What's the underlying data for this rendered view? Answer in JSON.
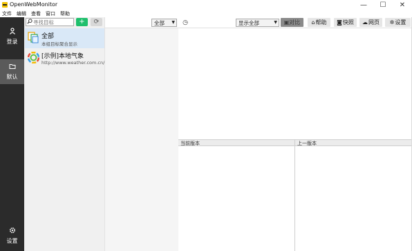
{
  "window": {
    "title": "OpenWebMonitor",
    "minimize": "—",
    "maximize": "☐",
    "close": "✕"
  },
  "menu": [
    "文件",
    "编辑",
    "查看",
    "窗口",
    "帮助"
  ],
  "nav": {
    "login": {
      "label": "登录",
      "icon": "person-icon"
    },
    "default": {
      "label": "默认",
      "icon": "folder-icon"
    },
    "settings": {
      "label": "设置",
      "icon": "gear-icon"
    }
  },
  "search": {
    "placeholder": "寻找目标",
    "value": ""
  },
  "list": {
    "items": [
      {
        "title": "全部",
        "subtitle": "本组目标聚合显示",
        "selected": true
      },
      {
        "title": "[示例]本地气象",
        "subtitle": "http://www.weather.com.cn/",
        "selected": false
      }
    ]
  },
  "toolbar": {
    "filter_select": "全部",
    "display_select": "显示全部",
    "compare": "▣对比",
    "help": "帮助",
    "snapshot": "快照",
    "webpage": "网页",
    "settings": "设置"
  },
  "panels": {
    "current_version": "当前版本",
    "previous_version": "上一版本"
  },
  "colors": {
    "nav_bg": "#2b2b2b",
    "nav_active": "#5a5a5a",
    "add_button": "#1fbf6c",
    "selected_item": "#d9e8f7"
  }
}
